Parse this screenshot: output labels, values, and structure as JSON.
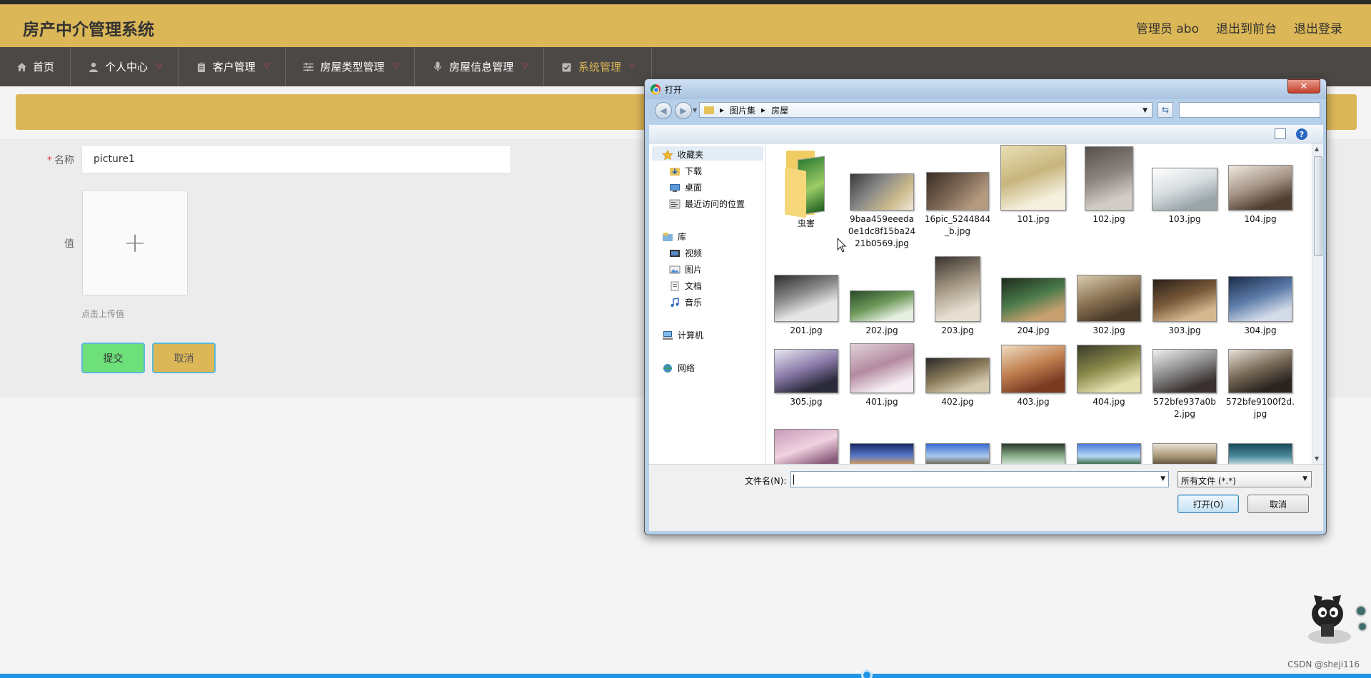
{
  "header": {
    "title": "房产中介管理系统",
    "admin_label": "管理员 abo",
    "front_link": "退出到前台",
    "logout_link": "退出登录"
  },
  "nav": {
    "items": [
      {
        "label": "首页",
        "icon": "home-icon",
        "has_dropdown": false
      },
      {
        "label": "个人中心",
        "icon": "user-icon",
        "has_dropdown": true
      },
      {
        "label": "客户管理",
        "icon": "clipboard-icon",
        "has_dropdown": true
      },
      {
        "label": "房屋类型管理",
        "icon": "sliders-icon",
        "has_dropdown": true
      },
      {
        "label": "房屋信息管理",
        "icon": "microphone-icon",
        "has_dropdown": true
      },
      {
        "label": "系统管理",
        "icon": "checklist-icon",
        "has_dropdown": true,
        "active": true
      }
    ]
  },
  "form": {
    "name_label": "名称",
    "name_value": "picture1",
    "value_label": "值",
    "upload_plus": "+",
    "upload_tip": "点击上传值",
    "submit_label": "提交",
    "cancel_label": "取消"
  },
  "dialog": {
    "title": "打开",
    "close_symbol": "✕",
    "breadcrumb": [
      "图片集",
      "房屋"
    ],
    "nav_pane": {
      "favorites": "收藏夹",
      "downloads": "下载",
      "desktop": "桌面",
      "recent": "最近访问的位置",
      "libraries": "库",
      "videos": "视频",
      "pictures": "图片",
      "documents": "文档",
      "music": "音乐",
      "computer": "计算机",
      "network": "网络"
    },
    "files": [
      {
        "name": "虫害",
        "kind": "folder"
      },
      {
        "name": "9baa459eeeda0e1dc8f15ba2421b0569.jpg",
        "kind": "image"
      },
      {
        "name": "16pic_5244844_b.jpg",
        "kind": "image"
      },
      {
        "name": "101.jpg",
        "kind": "image"
      },
      {
        "name": "102.jpg",
        "kind": "image"
      },
      {
        "name": "103.jpg",
        "kind": "image"
      },
      {
        "name": "104.jpg",
        "kind": "image"
      },
      {
        "name": "201.jpg",
        "kind": "image"
      },
      {
        "name": "202.jpg",
        "kind": "image"
      },
      {
        "name": "203.jpg",
        "kind": "image"
      },
      {
        "name": "204.jpg",
        "kind": "image"
      },
      {
        "name": "302.jpg",
        "kind": "image"
      },
      {
        "name": "303.jpg",
        "kind": "image"
      },
      {
        "name": "304.jpg",
        "kind": "image"
      },
      {
        "name": "305.jpg",
        "kind": "image"
      },
      {
        "name": "401.jpg",
        "kind": "image"
      },
      {
        "name": "402.jpg",
        "kind": "image"
      },
      {
        "name": "403.jpg",
        "kind": "image"
      },
      {
        "name": "404.jpg",
        "kind": "image"
      },
      {
        "name": "572bfe937a0b2.jpg",
        "kind": "image"
      },
      {
        "name": "572bfe9100f2d.jpg",
        "kind": "image"
      },
      {
        "name": "",
        "kind": "image"
      },
      {
        "name": "",
        "kind": "image"
      },
      {
        "name": "",
        "kind": "image"
      },
      {
        "name": "",
        "kind": "image"
      },
      {
        "name": "",
        "kind": "image"
      },
      {
        "name": "",
        "kind": "image"
      },
      {
        "name": "",
        "kind": "image"
      }
    ],
    "filename_label": "文件名(N):",
    "filename_value": "",
    "filetype_value": "所有文件 (*.*)",
    "open_label": "打开(O)",
    "cancel_label": "取消"
  },
  "watermark": "CSDN @sheji116",
  "colors": {
    "header": "#dcb757",
    "nav": "#4b4846",
    "submit": "#6ee07a",
    "accent": "#2196e6"
  }
}
